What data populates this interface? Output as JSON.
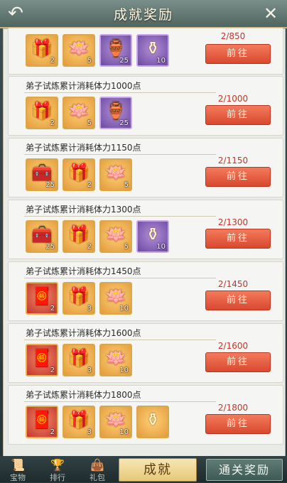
{
  "window": {
    "title": "成就奖励"
  },
  "action_label": "前往",
  "rows": [
    {
      "title": "",
      "progress": "2/850",
      "items": [
        {
          "icon": "gift-box-icon",
          "glyph": "🎁",
          "qty": "2",
          "tone": "gold"
        },
        {
          "icon": "lotus-icon",
          "glyph": "🪷",
          "qty": "5",
          "tone": "gold"
        },
        {
          "icon": "treasure-jar-icon",
          "glyph": "🏺",
          "qty": "25",
          "tone": "purple"
        },
        {
          "icon": "vase-icon",
          "glyph": "⚱",
          "qty": "10",
          "tone": "purple"
        }
      ]
    },
    {
      "title": "弟子试炼累计消耗体力1000点",
      "progress": "2/1000",
      "items": [
        {
          "icon": "gift-box-icon",
          "glyph": "🎁",
          "qty": "2",
          "tone": "gold"
        },
        {
          "icon": "lotus-icon",
          "glyph": "🪷",
          "qty": "5",
          "tone": "gold"
        },
        {
          "icon": "treasure-jar-icon",
          "glyph": "🏺",
          "qty": "25",
          "tone": "purple"
        }
      ]
    },
    {
      "title": "弟子试炼累计消耗体力1150点",
      "progress": "2/1150",
      "items": [
        {
          "icon": "treasure-chest-icon",
          "glyph": "🧰",
          "qty": "25",
          "tone": "gold"
        },
        {
          "icon": "gift-box-icon",
          "glyph": "🎁",
          "qty": "2",
          "tone": "gold"
        },
        {
          "icon": "lotus-icon",
          "glyph": "🪷",
          "qty": "5",
          "tone": "gold"
        }
      ]
    },
    {
      "title": "弟子试炼累计消耗体力1300点",
      "progress": "2/1300",
      "items": [
        {
          "icon": "treasure-chest-icon",
          "glyph": "🧰",
          "qty": "25",
          "tone": "gold"
        },
        {
          "icon": "gift-box-icon",
          "glyph": "🎁",
          "qty": "2",
          "tone": "gold"
        },
        {
          "icon": "lotus-icon",
          "glyph": "🪷",
          "qty": "5",
          "tone": "gold"
        },
        {
          "icon": "vase-icon",
          "glyph": "⚱",
          "qty": "10",
          "tone": "purple"
        }
      ]
    },
    {
      "title": "弟子试炼累计消耗体力1450点",
      "progress": "2/1450",
      "items": [
        {
          "icon": "red-chest-icon",
          "glyph": "🧧",
          "qty": "2",
          "tone": "red"
        },
        {
          "icon": "gift-box-icon",
          "glyph": "🎁",
          "qty": "3",
          "tone": "gold"
        },
        {
          "icon": "lotus-icon",
          "glyph": "🪷",
          "qty": "10",
          "tone": "gold"
        }
      ]
    },
    {
      "title": "弟子试炼累计消耗体力1600点",
      "progress": "2/1600",
      "items": [
        {
          "icon": "red-chest-icon",
          "glyph": "🧧",
          "qty": "2",
          "tone": "red"
        },
        {
          "icon": "gift-box-icon",
          "glyph": "🎁",
          "qty": "3",
          "tone": "gold"
        },
        {
          "icon": "lotus-icon",
          "glyph": "🪷",
          "qty": "10",
          "tone": "gold"
        }
      ]
    },
    {
      "title": "弟子试炼累计消耗体力1800点",
      "progress": "2/1800",
      "items": [
        {
          "icon": "red-chest-icon",
          "glyph": "🧧",
          "qty": "2",
          "tone": "red"
        },
        {
          "icon": "gift-box-icon",
          "glyph": "🎁",
          "qty": "3",
          "tone": "gold"
        },
        {
          "icon": "lotus-icon",
          "glyph": "🪷",
          "qty": "10",
          "tone": "gold"
        },
        {
          "icon": "vase-icon",
          "glyph": "⚱",
          "qty": "",
          "tone": "gold"
        }
      ]
    }
  ],
  "footer": {
    "icons": [
      {
        "icon": "scroll-icon",
        "glyph": "📜",
        "label": "宝物"
      },
      {
        "icon": "ranking-icon",
        "glyph": "🏆",
        "label": "排行"
      },
      {
        "icon": "bag-icon",
        "glyph": "👜",
        "label": "礼包"
      }
    ],
    "tab_achievement": "成就",
    "tab_clear_reward": "通关奖励"
  }
}
